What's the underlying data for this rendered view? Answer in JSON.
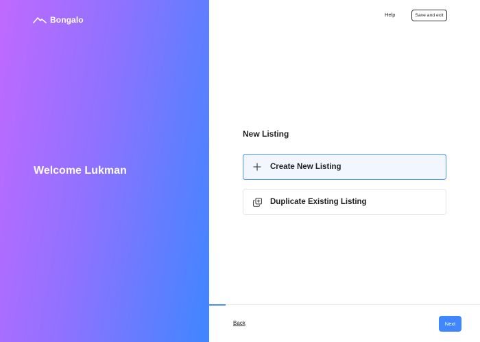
{
  "brand": {
    "name": "Bongalo",
    "icon": "mountain-logo-icon"
  },
  "welcome_text": "Welcome Lukman",
  "header": {
    "help_label": "Help",
    "save_exit_label": "Save and exit"
  },
  "main": {
    "section_title": "New Listing",
    "options": [
      {
        "label": "Create New Listing",
        "icon": "plus-icon",
        "selected": true
      },
      {
        "label": "Duplicate Existing Listing",
        "icon": "duplicate-icon",
        "selected": false
      }
    ]
  },
  "footer": {
    "back_label": "Back",
    "next_label": "Next",
    "progress": 0.06
  },
  "colors": {
    "accent": "#3f86ff",
    "gradient_start": "#c069ff",
    "gradient_end": "#3f86ff",
    "selected_bg": "#f2f6ff"
  }
}
